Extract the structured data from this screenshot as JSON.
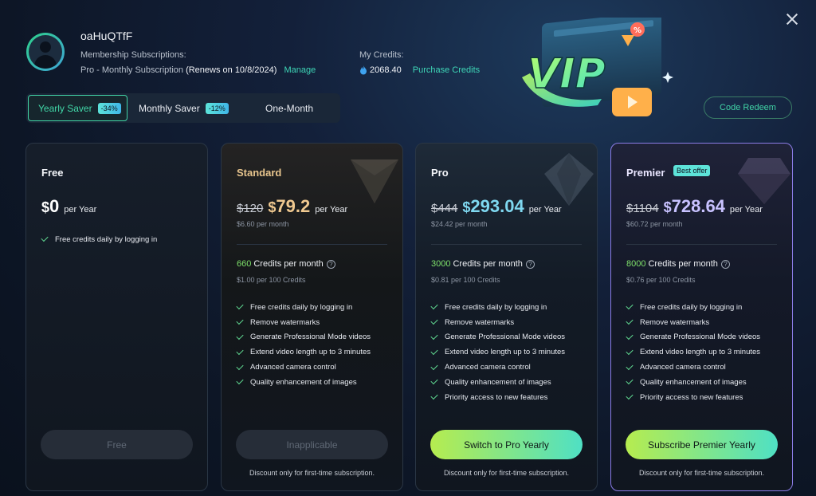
{
  "user": {
    "name": "oaHuQTfF",
    "membership_label": "Membership Subscriptions:",
    "plan": "Pro - Monthly Subscription",
    "renews": "(Renews on 10/8/2024)",
    "manage": "Manage"
  },
  "credits": {
    "label": "My Credits:",
    "amount": "2068.40",
    "purchase": "Purchase Credits"
  },
  "vip_art": {
    "text": "VIP"
  },
  "tabs": [
    {
      "label": "Yearly Saver",
      "badge": "-34%"
    },
    {
      "label": "Monthly Saver",
      "badge": "-12%"
    },
    {
      "label": "One-Month",
      "badge": ""
    }
  ],
  "code_redeem": "Code Redeem",
  "plans": [
    {
      "title": "Free",
      "new_cur": "$",
      "new_price": "0",
      "per": "per Year",
      "features": [
        "Free credits daily by logging in"
      ],
      "cta": "Free"
    },
    {
      "title": "Standard",
      "old_price": "$120",
      "new_cur": "$",
      "new_price": "79.2",
      "per": "per Year",
      "monthly": "$6.60 per month",
      "credits_num": "660",
      "credits_text": "Credits per month",
      "credits_sub": "$1.00 per 100 Credits",
      "features": [
        "Free credits daily by logging in",
        "Remove watermarks",
        "Generate Professional Mode videos",
        "Extend video length up to 3 minutes",
        "Advanced camera control",
        "Quality enhancement of images"
      ],
      "cta": "Inapplicable",
      "disclaimer": "Discount only for first-time subscription."
    },
    {
      "title": "Pro",
      "old_price": "$444",
      "new_cur": "$",
      "new_price": "293.04",
      "per": "per Year",
      "monthly": "$24.42 per month",
      "credits_num": "3000",
      "credits_text": "Credits per month",
      "credits_sub": "$0.81 per 100 Credits",
      "features": [
        "Free credits daily by logging in",
        "Remove watermarks",
        "Generate Professional Mode videos",
        "Extend video length up to 3 minutes",
        "Advanced camera control",
        "Quality enhancement of images",
        "Priority access to new features"
      ],
      "cta": "Switch to Pro Yearly",
      "disclaimer": "Discount only for first-time subscription."
    },
    {
      "title": "Premier",
      "badge": "Best offer",
      "old_price": "$1104",
      "new_cur": "$",
      "new_price": "728.64",
      "per": "per Year",
      "monthly": "$60.72 per month",
      "credits_num": "8000",
      "credits_text": "Credits per month",
      "credits_sub": "$0.76 per 100 Credits",
      "features": [
        "Free credits daily by logging in",
        "Remove watermarks",
        "Generate Professional Mode videos",
        "Extend video length up to 3 minutes",
        "Advanced camera control",
        "Quality enhancement of images",
        "Priority access to new features"
      ],
      "cta": "Subscribe Premier Yearly",
      "disclaimer": "Discount only for first-time subscription."
    }
  ],
  "colors": {
    "accent": "#41d3a6",
    "credits_green": "#7ee06a",
    "cta_gradient_start": "#b6ec4f",
    "cta_gradient_end": "#4fe0c4",
    "premier_border": "#8b7ce6"
  }
}
